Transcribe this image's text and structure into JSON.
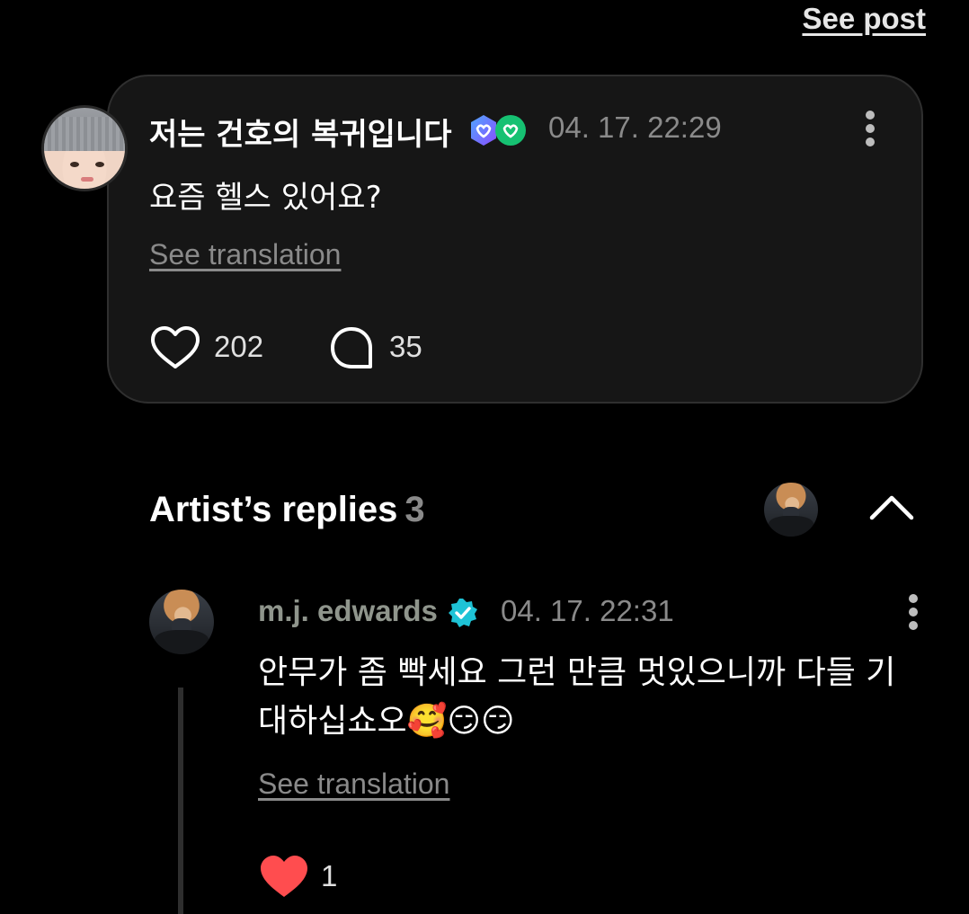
{
  "header": {
    "see_post_label": "See post"
  },
  "post": {
    "username": "저는 건호의 복귀입니다",
    "timestamp": "04. 17. 22:29",
    "text": "요즘 헬스 있어요?",
    "see_translation_label": "See translation",
    "likes": "202",
    "comments": "35"
  },
  "replies_section": {
    "title": "Artist’s replies",
    "count": "3"
  },
  "reply": {
    "username": "m.j. edwards",
    "timestamp": "04. 17. 22:31",
    "text": "안무가 좀 빡세요 그런 만큼 멋있으니까 다들 기대하십쇼오🥰😏😏",
    "see_translation_label": "See translation",
    "likes": "1"
  },
  "colors": {
    "background": "#000000",
    "card": "#161616",
    "muted_text": "#8a8a8a",
    "verified_badge": "#1ec3d6",
    "like_active": "#ff4d4f",
    "badge_purple": "#6b5cff",
    "badge_green": "#16c172"
  },
  "icons": {
    "post_like": "heart-outline-icon",
    "post_comment": "comment-bubble-icon",
    "reply_like": "heart-filled-icon",
    "collapse": "chevron-up-icon",
    "menu": "more-vertical-icon",
    "verified": "verified-badge-icon"
  }
}
